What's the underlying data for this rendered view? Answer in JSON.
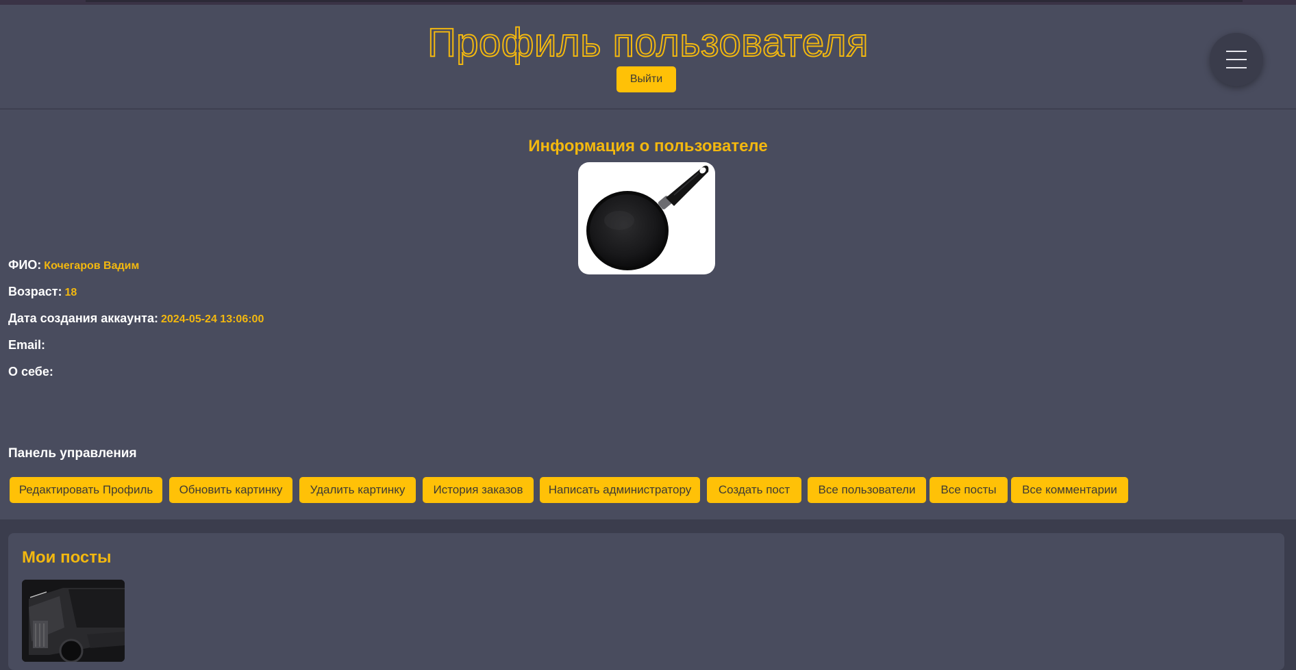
{
  "header": {
    "title": "Профиль пользователя",
    "logout_label": "Выйти",
    "menu_icon": "hamburger-menu-icon"
  },
  "info": {
    "heading": "Информация о пользователе",
    "avatar_icon": "frying-pan-image",
    "fields": {
      "fio_label": "ФИО:",
      "fio_value": "Кочегаров Вадим",
      "age_label": "Возраст:",
      "age_value": "18",
      "created_label": "Дата создания аккаунта:",
      "created_value": "2024-05-24 13:06:00",
      "email_label": "Email:",
      "email_value": "",
      "about_label": "О себе:",
      "about_value": ""
    }
  },
  "panel": {
    "title": "Панель управления",
    "buttons": [
      "Редактировать Профиль",
      "Обновить картинку",
      "Удалить картинку",
      "История заказов",
      "Написать администратору",
      "Создать пост",
      "Все пользователи",
      "Все посты",
      "Все комментарии"
    ]
  },
  "posts": {
    "title": "Мои посты",
    "thumb_icon": "truck-photo-thumbnail"
  },
  "colors": {
    "accent": "#ffc107",
    "accent_text": "#f3b80f",
    "surface": "#494c5e",
    "background": "#3b3d4d",
    "button_text": "#3d3a35"
  }
}
